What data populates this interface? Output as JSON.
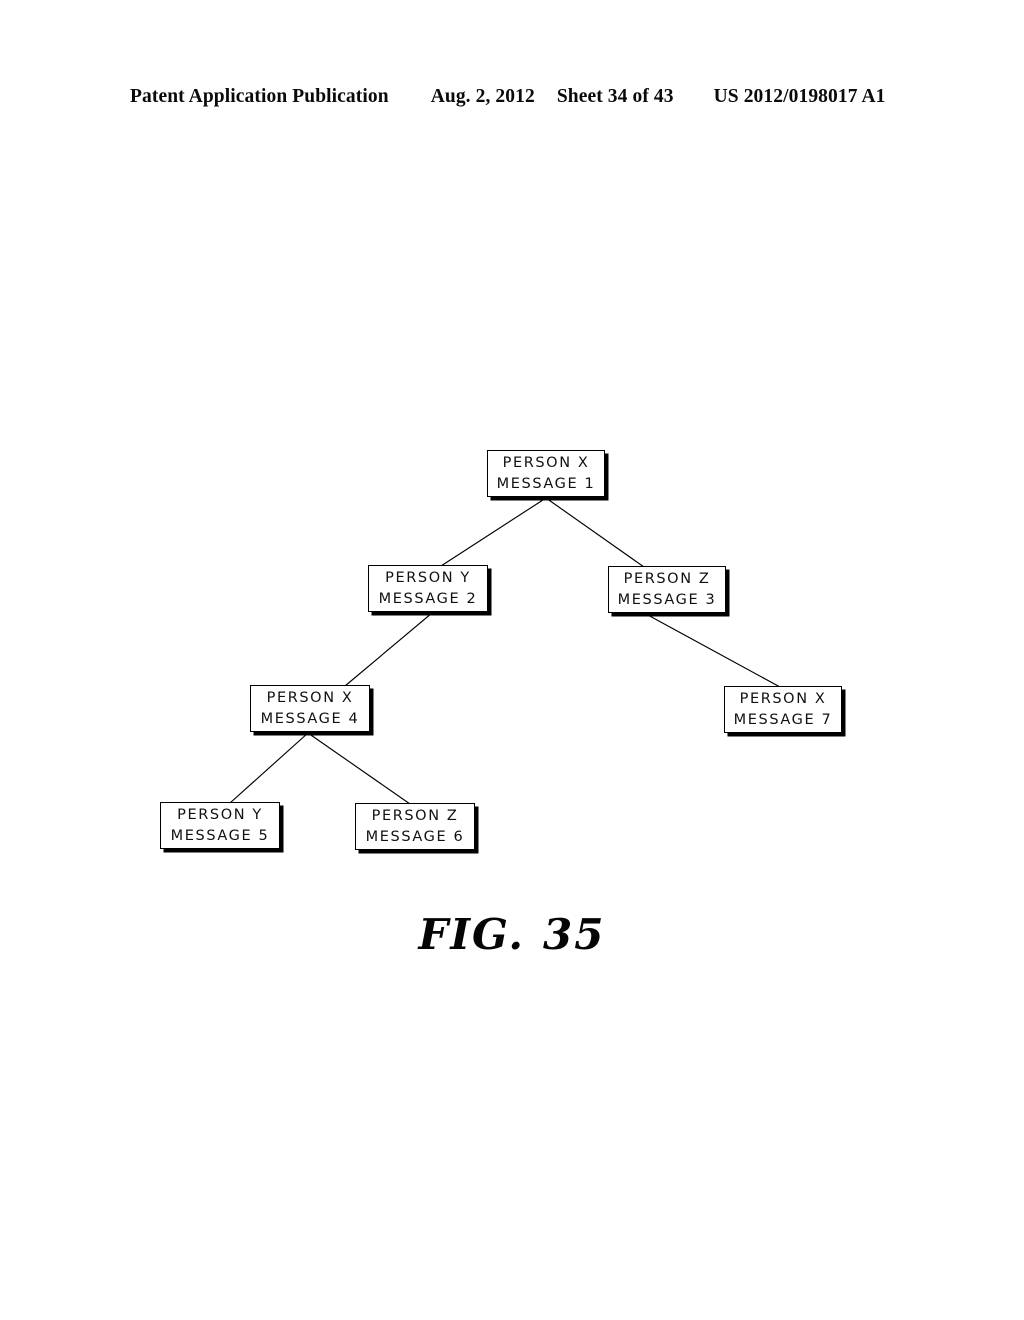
{
  "header": {
    "publication": "Patent Application Publication",
    "date": "Aug. 2, 2012",
    "sheet": "Sheet 34 of 43",
    "patent_number": "US 2012/0198017 A1"
  },
  "figure": {
    "caption_label": "FIG.",
    "caption_number": "35",
    "nodes": [
      {
        "id": "node-1",
        "person": "PERSON  X",
        "message": "MESSAGE  1"
      },
      {
        "id": "node-2",
        "person": "PERSON  Y",
        "message": "MESSAGE  2"
      },
      {
        "id": "node-3",
        "person": "PERSON  Z",
        "message": "MESSAGE  3"
      },
      {
        "id": "node-4",
        "person": "PERSON  X",
        "message": "MESSAGE  4"
      },
      {
        "id": "node-5",
        "person": "PERSON  Y",
        "message": "MESSAGE  5"
      },
      {
        "id": "node-6",
        "person": "PERSON  Z",
        "message": "MESSAGE  6"
      },
      {
        "id": "node-7",
        "person": "PERSON  X",
        "message": "MESSAGE  7"
      }
    ],
    "edges": [
      {
        "from": "node-1",
        "to": "node-2"
      },
      {
        "from": "node-1",
        "to": "node-3"
      },
      {
        "from": "node-2",
        "to": "node-4"
      },
      {
        "from": "node-3",
        "to": "node-7"
      },
      {
        "from": "node-4",
        "to": "node-5"
      },
      {
        "from": "node-4",
        "to": "node-6"
      }
    ],
    "line_color": "#000000",
    "box_border_color": "#000000",
    "background_color": "#ffffff"
  }
}
